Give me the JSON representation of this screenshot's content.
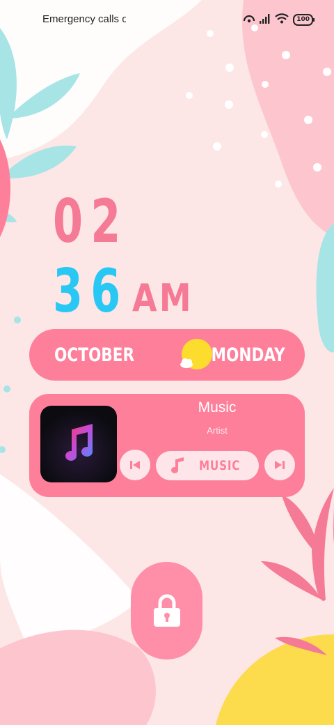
{
  "status_bar": {
    "carrier_text": "Emergency calls o",
    "battery": "100",
    "icons": [
      "hotspot-icon",
      "signal-icon",
      "wifi-icon",
      "battery-icon"
    ]
  },
  "clock": {
    "hour": "02",
    "minute": "36",
    "period": "AM"
  },
  "date": {
    "month": "OCTOBER",
    "weekday": "MONDAY",
    "weather_icon": "sun-cloud-icon"
  },
  "music": {
    "title": "Music",
    "artist": "Artist",
    "button_label": "MUSIC",
    "icons": [
      "apple-music-icon",
      "previous-icon",
      "music-note-icon",
      "next-icon"
    ]
  },
  "lock": {
    "icon": "lock-icon"
  },
  "colors": {
    "background": "#fde6e6",
    "accent_pink": "#fd7f9a",
    "accent_blue": "#29c8f4",
    "accent_yellow": "#fcdc4d"
  }
}
